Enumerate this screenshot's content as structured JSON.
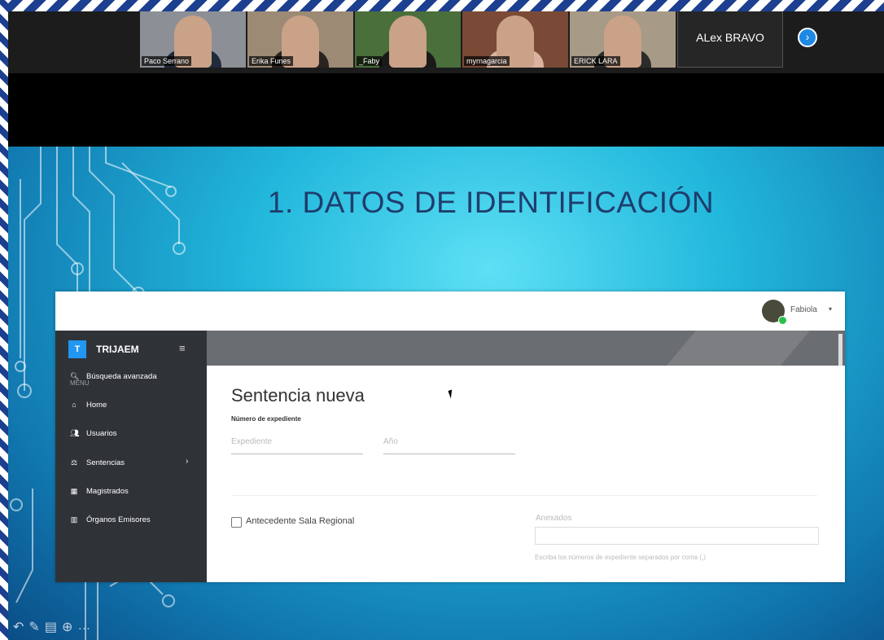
{
  "meeting": {
    "participants": [
      {
        "name": "Paco Serrano",
        "bg": "#8d8f96",
        "shirt": "#1f2a3a"
      },
      {
        "name": "Erika Funes",
        "bg": "#9c8a74",
        "shirt": "#2a2320"
      },
      {
        "name": "_Faby",
        "bg": "#4a6f3a",
        "shirt": "#1a1a1a"
      },
      {
        "name": "myrnagarcia",
        "bg": "#7a4a36",
        "shirt": "#d9b2a0"
      },
      {
        "name": "ERICK LARA",
        "bg": "#a79a86",
        "shirt": "#2b2b2b"
      }
    ],
    "named_tile": "ALex BRAVO",
    "next_icon": "chevron-right-icon"
  },
  "slide": {
    "title": "1. DATOS DE IDENTIFICACIÓN"
  },
  "app": {
    "user": {
      "name": "Fabiola",
      "caret": "▾"
    },
    "brand": {
      "logo": "T",
      "name": "TRIJAEM",
      "collapse_icon": "≡"
    },
    "menu_label": "MENU",
    "menu": [
      {
        "icon": "search-icon",
        "glyph": "🔍︎",
        "label": "Búsqueda avanzada"
      },
      {
        "icon": "home-icon",
        "glyph": "⌂",
        "label": "Home"
      },
      {
        "icon": "users-icon",
        "glyph": "👥︎",
        "label": "Usuarios"
      },
      {
        "icon": "gavel-icon",
        "glyph": "⚖",
        "label": "Sentencias",
        "arrow": "›"
      },
      {
        "icon": "id-card-icon",
        "glyph": "▦",
        "label": "Magistrados"
      },
      {
        "icon": "building-icon",
        "glyph": "▥",
        "label": "Órganos Emisores"
      }
    ],
    "form": {
      "title": "Sentencia nueva",
      "section": "Número de expediente",
      "expediente_placeholder": "Expediente",
      "anio_placeholder": "Año",
      "checkbox_label": "Antecedente Sala Regional",
      "anexados_label": "Anexados",
      "anexados_help": "Escriba los números de expediente separados por coma (,)"
    }
  },
  "colors": {
    "slide_title": "#1f3d6d",
    "sidebar": "#2f3338",
    "brand_accent": "#2196f3"
  }
}
